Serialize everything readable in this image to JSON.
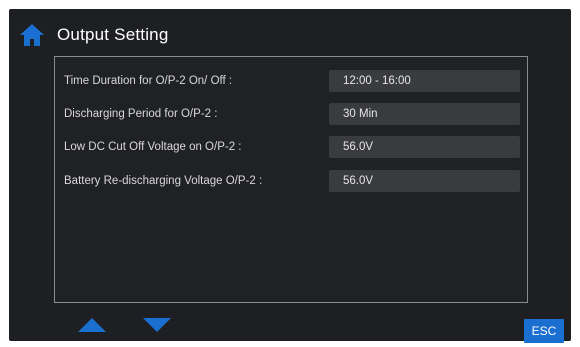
{
  "header": {
    "title": "Output Setting",
    "icon": "home-icon",
    "icon_color": "#1a6fd1"
  },
  "settings": [
    {
      "label": "Time Duration for O/P-2 On/ Off :",
      "value": "12:00 - 16:00"
    },
    {
      "label": "Discharging Period for O/P-2 :",
      "value": "30  Min"
    },
    {
      "label": "Low DC Cut Off Voltage on O/P-2 :",
      "value": "56.0V"
    },
    {
      "label": "Battery Re-discharging Voltage O/P-2 :",
      "value": "56.0V"
    }
  ],
  "footer": {
    "up_icon": "arrow-up-icon",
    "down_icon": "arrow-down-icon",
    "esc_label": "ESC",
    "accent_color": "#1a6fd1"
  }
}
